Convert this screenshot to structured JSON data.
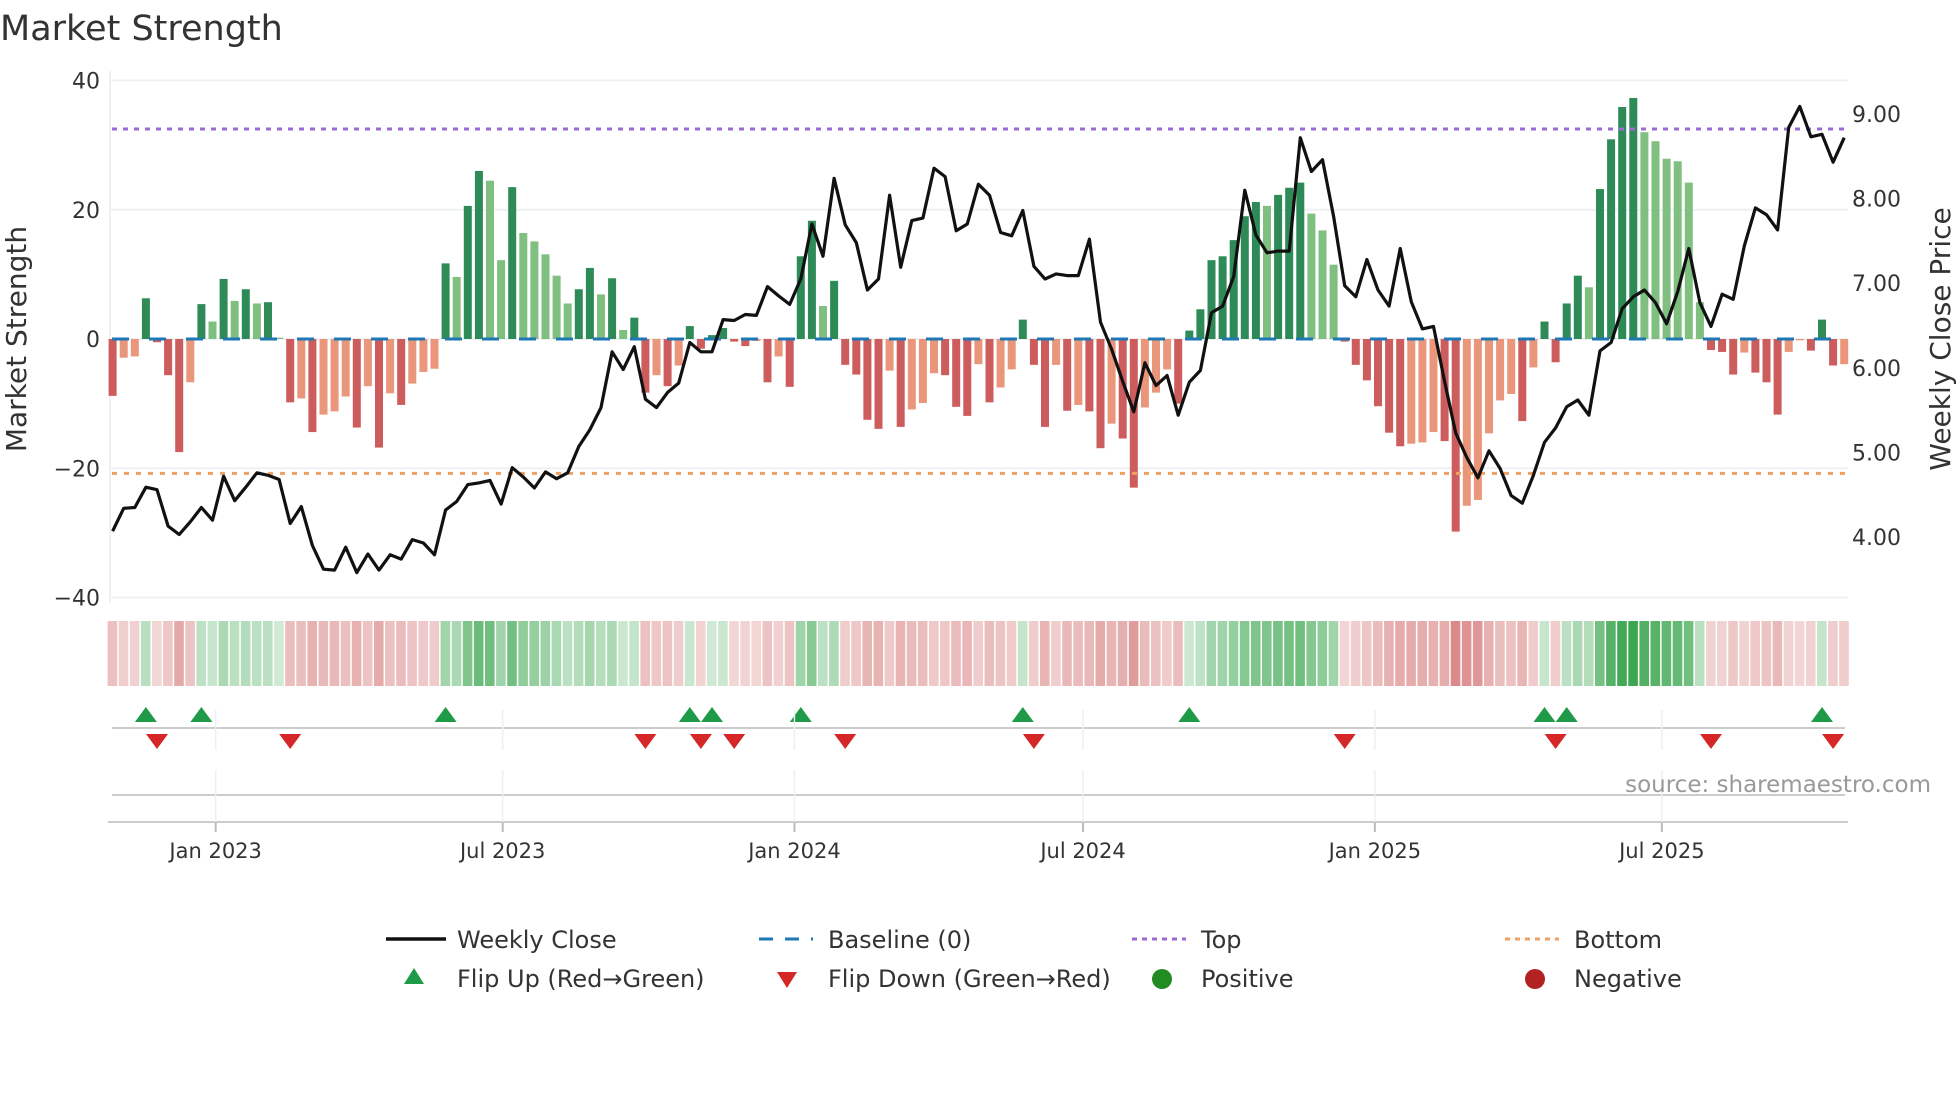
{
  "chart_data": {
    "type": "bar",
    "title": "Market Strength",
    "ylabel": "Market Strength",
    "y2label": "Weekly Close Price",
    "ylim": [
      -40,
      40
    ],
    "y2lim": [
      3.28,
      9.39
    ],
    "yticks": [
      40,
      20,
      0,
      -20,
      -40
    ],
    "y2ticks": [
      "4.00",
      "5.00",
      "6.00",
      "7.00",
      "8.00",
      "9.00"
    ],
    "start_date": "2022-10-28",
    "xticks": [
      {
        "label": "Jan 2023",
        "date": "2023-01-01"
      },
      {
        "label": "Jul 2023",
        "date": "2023-07-01"
      },
      {
        "label": "Jan 2024",
        "date": "2024-01-01"
      },
      {
        "label": "Jul 2024",
        "date": "2024-07-01"
      },
      {
        "label": "Jan 2025",
        "date": "2025-01-01"
      },
      {
        "label": "Jul 2025",
        "date": "2025-07-01"
      }
    ],
    "top_level": 32.5,
    "bottom_level": -20.8,
    "series": [
      {
        "name": "Market Strength",
        "values": [
          -8.8,
          -2.9,
          -2.7,
          6.3,
          -0.5,
          -5.6,
          -17.5,
          -6.7,
          5.4,
          2.7,
          9.3,
          5.9,
          7.7,
          5.5,
          5.7,
          0.2,
          -9.8,
          -9.2,
          -14.4,
          -11.7,
          -11.2,
          -8.9,
          -13.7,
          -7.3,
          -16.8,
          -8.4,
          -10.2,
          -6.9,
          -5.1,
          -4.6,
          11.7,
          9.6,
          20.6,
          26,
          24.5,
          12.2,
          23.5,
          16.4,
          15.1,
          13.1,
          9.8,
          5.5,
          7.7,
          11,
          6.9,
          9.4,
          1.4,
          3.3,
          -8.3,
          -5.6,
          -7.3,
          -4.1,
          2,
          -1.5,
          0.6,
          1.7,
          -0.4,
          -1.1,
          -0.3,
          -6.7,
          -2.7,
          -7.4,
          12.8,
          18.3,
          5.1,
          9,
          -4,
          -5.5,
          -12.5,
          -13.9,
          -4.9,
          -13.6,
          -10.9,
          -9.9,
          -5.3,
          -5.6,
          -10.5,
          -11.9,
          -3.9,
          -9.8,
          -7.5,
          -4.7,
          3,
          -4,
          -13.6,
          -4,
          -11.1,
          -10.2,
          -11.2,
          -16.9,
          -13.1,
          -15.4,
          -23,
          -10.6,
          -8.3,
          -4.7,
          -10,
          1.3,
          4.6,
          12.2,
          12.8,
          15.3,
          19,
          21.2,
          20.6,
          22.3,
          23.4,
          24.2,
          19.4,
          16.8,
          11.5,
          -0.4,
          -4,
          -6.4,
          -10.4,
          -14.5,
          -16.6,
          -16.2,
          -16.0,
          -14.4,
          -15.8,
          -29.8,
          -25.8,
          -24.9,
          -14.6,
          -9.5,
          -8.5,
          -12.7,
          -4.4,
          2.7,
          -3.6,
          5.5,
          9.8,
          8,
          23.2,
          30.9,
          35.9,
          37.3,
          32,
          30.6,
          27.9,
          27.5,
          24.2,
          5.7,
          -1.7,
          -2,
          -5.5,
          -2.1,
          -5.2,
          -6.7,
          -11.7,
          -2,
          -0.2,
          -1.8,
          3,
          -4.1,
          -3.9
        ]
      },
      {
        "name": "Weekly Close",
        "values": [
          4.07,
          4.34,
          4.35,
          4.59,
          4.56,
          4.13,
          4.03,
          4.18,
          4.35,
          4.2,
          4.72,
          4.43,
          4.59,
          4.76,
          4.73,
          4.68,
          4.16,
          4.36,
          3.9,
          3.62,
          3.61,
          3.88,
          3.58,
          3.8,
          3.61,
          3.79,
          3.74,
          3.97,
          3.93,
          3.79,
          4.32,
          4.42,
          4.62,
          4.64,
          4.67,
          4.39,
          4.82,
          4.71,
          4.58,
          4.77,
          4.69,
          4.76,
          5.07,
          5.27,
          5.53,
          6.19,
          5.98,
          6.25,
          5.63,
          5.53,
          5.71,
          5.82,
          6.3,
          6.19,
          6.19,
          6.57,
          6.56,
          6.63,
          6.62,
          6.96,
          6.85,
          6.75,
          7.05,
          7.7,
          7.32,
          8.24,
          7.69,
          7.48,
          6.92,
          7.05,
          8.04,
          7.19,
          7.74,
          7.77,
          8.36,
          8.26,
          7.62,
          7.7,
          8.17,
          8.04,
          7.6,
          7.56,
          7.86,
          7.2,
          7.05,
          7.11,
          7.09,
          7.09,
          7.52,
          6.54,
          6.22,
          5.84,
          5.48,
          6.06,
          5.79,
          5.91,
          5.44,
          5.83,
          5.97,
          6.65,
          6.73,
          7.08,
          8.1,
          7.57,
          7.36,
          7.38,
          7.38,
          8.72,
          8.32,
          8.46,
          7.79,
          6.97,
          6.84,
          7.28,
          6.92,
          6.73,
          7.41,
          6.78,
          6.46,
          6.49,
          5.84,
          5.23,
          4.94,
          4.7,
          5.02,
          4.81,
          4.49,
          4.4,
          4.73,
          5.12,
          5.29,
          5.54,
          5.62,
          5.44,
          6.2,
          6.3,
          6.7,
          6.84,
          6.92,
          6.77,
          6.52,
          6.9,
          7.41,
          6.77,
          6.49,
          6.87,
          6.81,
          7.44,
          7.89,
          7.81,
          7.63,
          8.84,
          9.09,
          8.73,
          8.76,
          8.43,
          8.72
        ]
      }
    ],
    "legend": {
      "placement": "bottom",
      "weekly_close": "Weekly Close",
      "baseline": "Baseline (0)",
      "top": "Top",
      "bottom": "Bottom",
      "flip_up": "Flip Up (Red→Green)",
      "flip_down": "Flip Down (Green→Red)",
      "positive": "Positive",
      "negative": "Negative"
    },
    "source": "source: sharemaestro.com",
    "colors": {
      "pos_strong": "#2e8b57",
      "pos_weak": "#7fbf7f",
      "neg_strong": "#cd5c5c",
      "neg_weak": "#e9967a",
      "line": "#111111",
      "baseline": "#1f77b4",
      "top": "#9b6ad6",
      "bottom": "#f0a060",
      "flip_up": "#1f9a48",
      "flip_down": "#d62728",
      "positive": "#228b22",
      "negative": "#b22222"
    }
  }
}
